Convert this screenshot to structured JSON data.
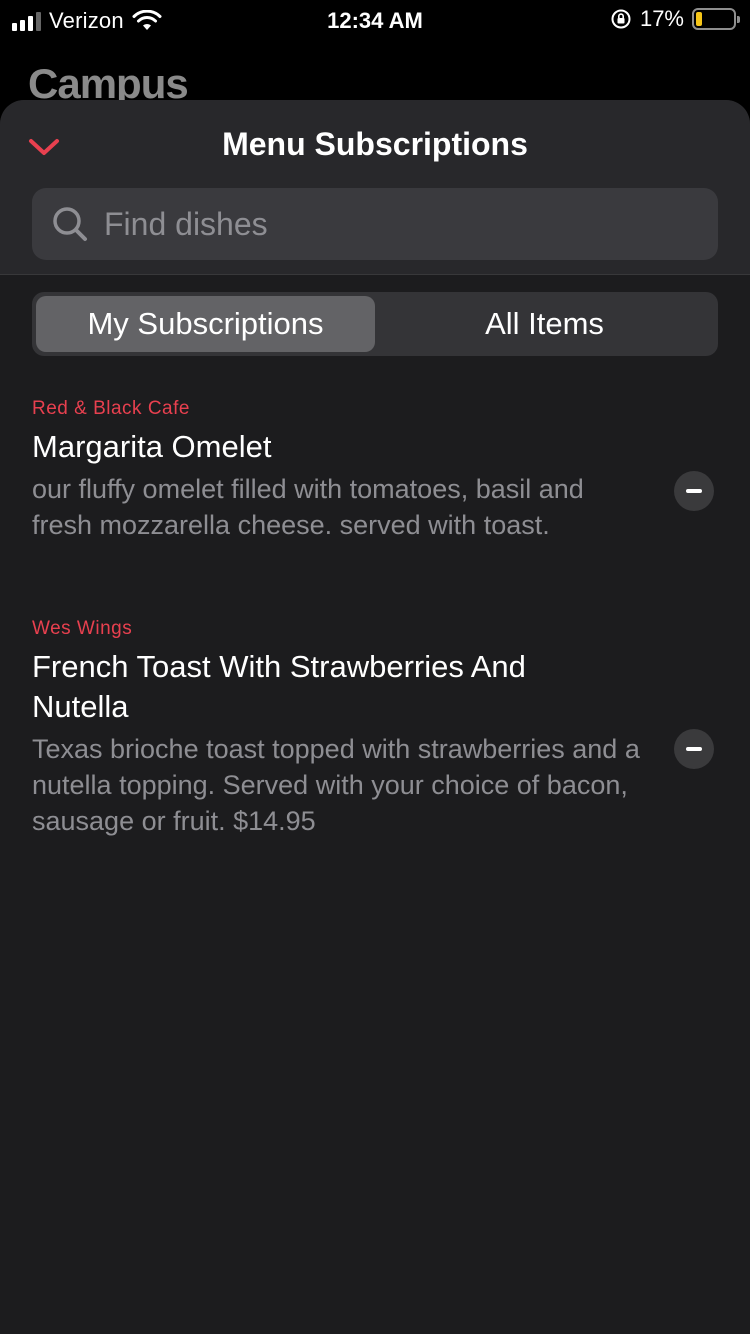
{
  "status_bar": {
    "carrier": "Verizon",
    "time": "12:34 AM",
    "battery_percent": "17%",
    "battery_level": 0.17,
    "icons": [
      "signal-icon",
      "wifi-icon",
      "rotation-lock-icon",
      "battery-icon"
    ]
  },
  "background": {
    "title": "Campus"
  },
  "sheet": {
    "title": "Menu Subscriptions",
    "close_icon": "chevron-down-icon",
    "search": {
      "placeholder": "Find dishes",
      "value": ""
    },
    "tabs": [
      {
        "label": "My Subscriptions",
        "selected": true
      },
      {
        "label": "All Items",
        "selected": false
      }
    ],
    "items": [
      {
        "source": "Red & Black Cafe",
        "title": "Margarita Omelet",
        "description": "our fluffy omelet filled with tomatoes, basil and fresh mozzarella cheese. served with toast."
      },
      {
        "source": "Wes Wings",
        "title": "French Toast With Strawberries And Nutella",
        "description": "Texas brioche toast topped with strawberries and a nutella topping. Served with your choice of bacon, sausage or fruit. $14.95"
      }
    ]
  },
  "colors": {
    "accent": "#e8404f",
    "sheet_bg": "#1c1c1e",
    "header_bg": "#28282b",
    "secondary_text": "#8e8e93"
  }
}
